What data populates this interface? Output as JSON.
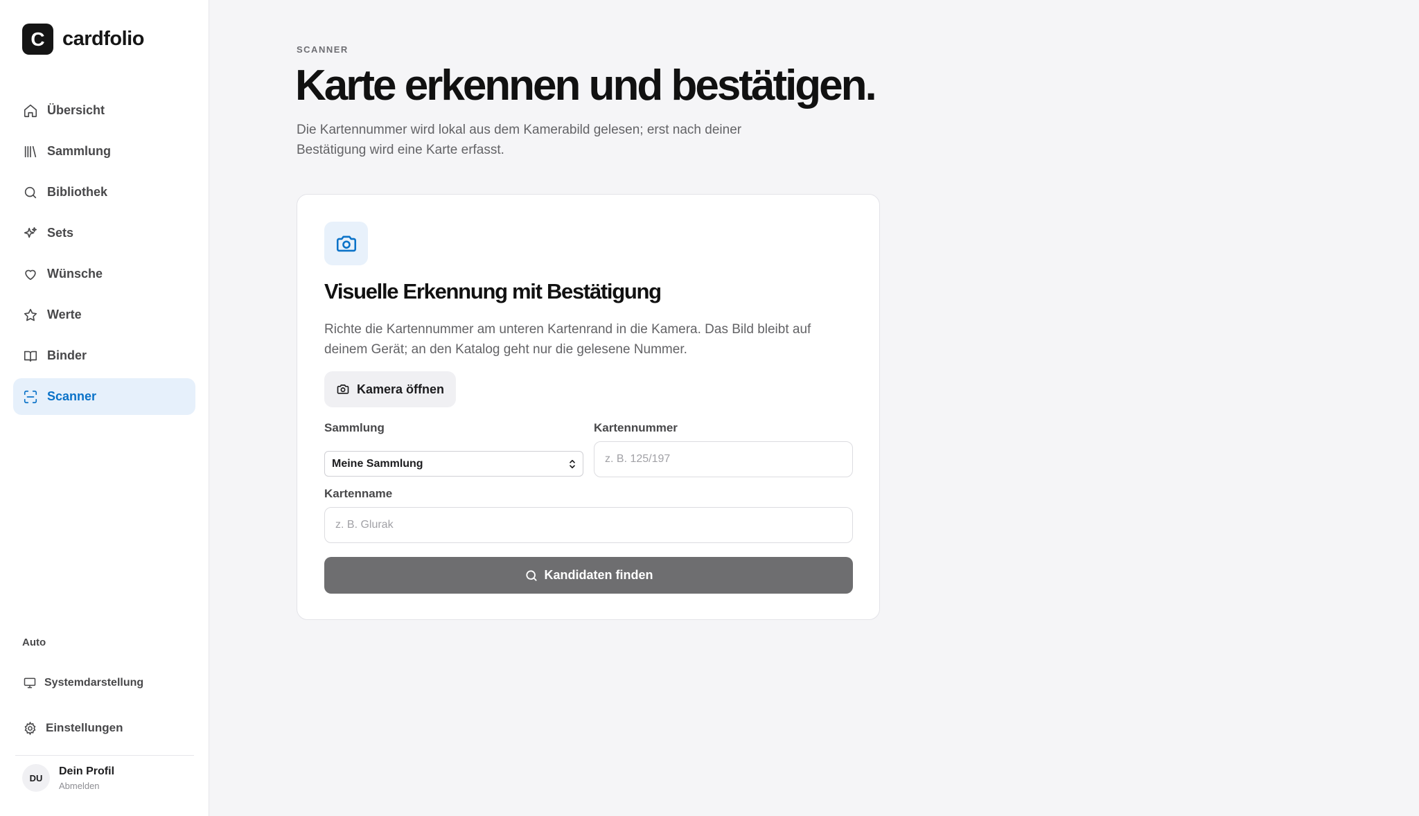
{
  "brand": {
    "mark": "C",
    "name": "cardfolio"
  },
  "nav": {
    "items": [
      {
        "label": "Übersicht",
        "icon": "home-icon"
      },
      {
        "label": "Sammlung",
        "icon": "library-icon"
      },
      {
        "label": "Bibliothek",
        "icon": "search-icon"
      },
      {
        "label": "Sets",
        "icon": "sparkles-icon"
      },
      {
        "label": "Wünsche",
        "icon": "heart-icon"
      },
      {
        "label": "Werte",
        "icon": "star-icon"
      },
      {
        "label": "Binder",
        "icon": "book-open-icon"
      },
      {
        "label": "Scanner",
        "icon": "scan-icon",
        "active": true
      }
    ]
  },
  "sidebar_footer": {
    "theme_label": "Auto",
    "theme_option": "Systemdarstellung",
    "settings": "Einstellungen"
  },
  "profile": {
    "initials": "DU",
    "name": "Dein Profil",
    "logout": "Abmelden"
  },
  "page": {
    "eyebrow": "SCANNER",
    "title": "Karte erkennen und bestätigen.",
    "description": "Die Kartennummer wird lokal aus dem Kamerabild gelesen; erst nach deiner Bestätigung wird eine Karte erfasst."
  },
  "card": {
    "title": "Visuelle Erkennung mit Bestätigung",
    "description": "Richte die Kartennummer am unteren Kartenrand in die Kamera. Das Bild bleibt auf deinem Gerät; an den Katalog geht nur die gelesene Nummer.",
    "camera_button": "Kamera öffnen",
    "collection_label": "Sammlung",
    "collection_value": "Meine Sammlung",
    "number_label": "Kartennummer",
    "number_placeholder": "z. B. 125/197",
    "name_label": "Kartenname",
    "name_placeholder": "z. B. Glurak",
    "submit_button": "Kandidaten finden"
  },
  "colors": {
    "accent": "#0a72c8",
    "active_bg": "#e6f0fb",
    "submit_bg": "#6e6e70"
  }
}
